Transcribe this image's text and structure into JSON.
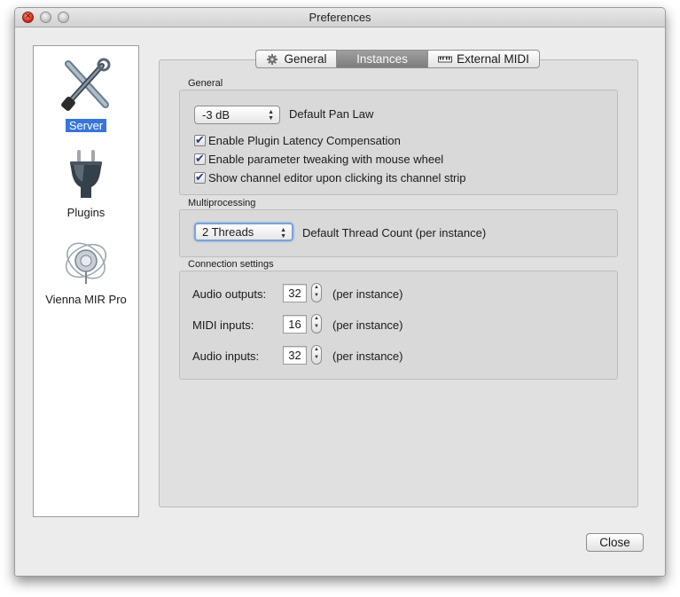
{
  "window": {
    "title": "Preferences"
  },
  "sidebar": {
    "items": [
      {
        "label": "Server",
        "icon": "wrench-screwdriver-icon",
        "selected": true
      },
      {
        "label": "Plugins",
        "icon": "plug-icon",
        "selected": false
      },
      {
        "label": "Vienna MIR Pro",
        "icon": "mir-pro-icon",
        "selected": false
      }
    ]
  },
  "tabs": [
    {
      "label": "General",
      "icon": "gear-icon",
      "active": false
    },
    {
      "label": "Instances",
      "icon": "",
      "active": true
    },
    {
      "label": "External MIDI",
      "icon": "keyboard-icon",
      "active": false
    }
  ],
  "general": {
    "title": "General",
    "pan_law_value": "-3 dB",
    "pan_law_label": "Default Pan Law",
    "checkboxes": [
      {
        "label": "Enable Plugin Latency Compensation",
        "checked": true
      },
      {
        "label": "Enable parameter tweaking with mouse wheel",
        "checked": true
      },
      {
        "label": "Show channel editor upon clicking its channel strip",
        "checked": true
      }
    ]
  },
  "multiprocessing": {
    "title": "Multiprocessing",
    "threads_value": "2 Threads",
    "threads_label": "Default Thread Count (per instance)"
  },
  "connection": {
    "title": "Connection settings",
    "rows": [
      {
        "label": "Audio outputs:",
        "value": "32",
        "suffix": "(per instance)"
      },
      {
        "label": "MIDI inputs:",
        "value": "16",
        "suffix": "(per instance)"
      },
      {
        "label": "Audio inputs:",
        "value": "32",
        "suffix": "(per instance)"
      }
    ]
  },
  "footer": {
    "close_label": "Close"
  },
  "colors": {
    "selection": "#3875d7",
    "active_tab": "#8a8a8a",
    "window_bg": "#ececec"
  }
}
